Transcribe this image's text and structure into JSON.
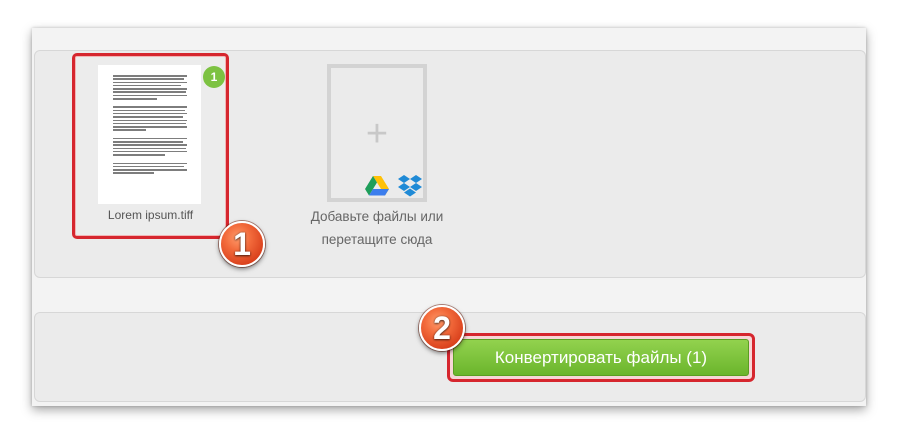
{
  "uploader": {
    "files": [
      {
        "name": "Lorem ipsum.tiff",
        "badge": "1"
      }
    ],
    "add_tile": {
      "plus": "+",
      "line1": "Добавьте файлы или",
      "line2": "перетащите сюда",
      "icons": [
        "google-drive-icon",
        "dropbox-icon"
      ]
    }
  },
  "actions": {
    "convert_label": "Конвертировать файлы (1)"
  },
  "markers": {
    "step1": "1",
    "step2": "2"
  },
  "colors": {
    "accent_green": "#7dc242",
    "highlight_red": "#d6262e",
    "marker_orange": "#f26a3b"
  }
}
